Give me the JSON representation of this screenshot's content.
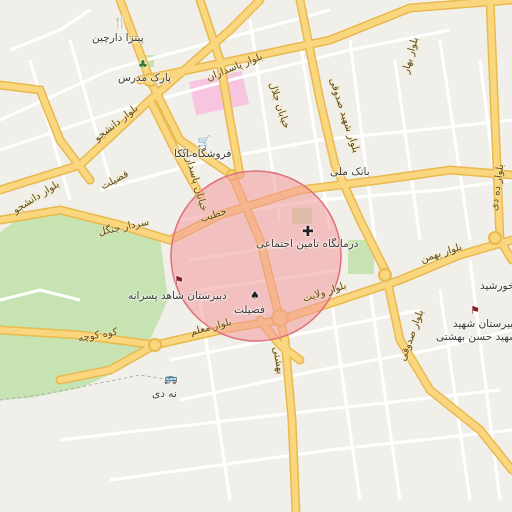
{
  "map": {
    "colors": {
      "background": "#f1efe9",
      "major_road": "#fad67e",
      "major_road_casing": "#e9b94e",
      "minor_road": "#ffffff",
      "park": "#c7e3b2",
      "highlight_circle": "#f29a9d",
      "pink_block": "#f7c5e0"
    },
    "highlight": {
      "shape": "circle",
      "label": "درمانگاه تامین اجتماعی"
    },
    "places": [
      {
        "id": "pizza-darchin",
        "label": "پیتزا دارچین",
        "icon": "restaurant-icon"
      },
      {
        "id": "park-modarres",
        "label": "پارک مدرس",
        "icon": "park-icon"
      },
      {
        "id": "atka",
        "label": "فروشگاه اتکا",
        "icon": "shopping-cart-icon"
      },
      {
        "id": "bank-melli",
        "label": "بانک ملی",
        "icon": "none"
      },
      {
        "id": "clinic",
        "label": "درمانگاه تامین اجتماعی",
        "icon": "hospital-cross-icon"
      },
      {
        "id": "school-shahed",
        "label": "دبیرستان شاهد پسرانه",
        "icon": "school-icon"
      },
      {
        "id": "fazilat",
        "label": "فضیلت",
        "icon": "tree-icon"
      },
      {
        "id": "nahdey",
        "label": "نه دی",
        "icon": "bus-icon"
      },
      {
        "id": "school-shahid",
        "label": "دبیرستان شهید\nشهید حسن بهشتی",
        "icon": "school-icon"
      },
      {
        "id": "khorshid",
        "label": "خورشید",
        "icon": "none"
      }
    ],
    "roads": [
      {
        "id": "pasdaran",
        "label": "بلوار پاسداران"
      },
      {
        "id": "daneshjoo1",
        "label": "بلوار دانشجو"
      },
      {
        "id": "daneshjoo2",
        "label": "بلوار دانشجو"
      },
      {
        "id": "fazilat",
        "label": "فضیلت"
      },
      {
        "id": "jangal",
        "label": "سردار جنگل"
      },
      {
        "id": "khatib",
        "label": "خطیب"
      },
      {
        "id": "bahar",
        "label": "بلوار بهار"
      },
      {
        "id": "sadoughi",
        "label": "بلوار شهید صدوقی"
      },
      {
        "id": "sadoughi2",
        "label": "بلوار صدوقی"
      },
      {
        "id": "khiaban-jalal",
        "label": "خیابان جلال"
      },
      {
        "id": "velayat",
        "label": "بلوار ولایت"
      },
      {
        "id": "moalem",
        "label": "بلوار معلم"
      },
      {
        "id": "koohe",
        "label": "کوه کوچه"
      },
      {
        "id": "beheshti",
        "label": "بهشتی"
      },
      {
        "id": "bahman",
        "label": "بلوار بهمن"
      },
      {
        "id": "dey",
        "label": "بلوار ده دی"
      },
      {
        "id": "fazilat-st",
        "label": "خیابان پاسداران"
      }
    ]
  }
}
